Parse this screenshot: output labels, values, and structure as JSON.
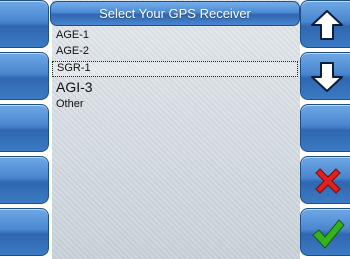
{
  "dialog": {
    "title": "Select Your GPS Receiver"
  },
  "receivers": [
    {
      "label": "AGE-1",
      "selected": false
    },
    {
      "label": "AGE-2",
      "selected": false
    },
    {
      "label": "SGR-1",
      "selected": true
    },
    {
      "label": "AGI-3",
      "selected": false
    },
    {
      "label": "Other",
      "selected": false
    }
  ],
  "right_buttons": [
    "up-arrow-icon",
    "down-arrow-icon",
    "blank",
    "cancel-x-icon",
    "confirm-check-icon"
  ],
  "colors": {
    "button_blue": "#3c7ac4",
    "cancel_red": "#e0201c",
    "confirm_green": "#33b21d"
  }
}
